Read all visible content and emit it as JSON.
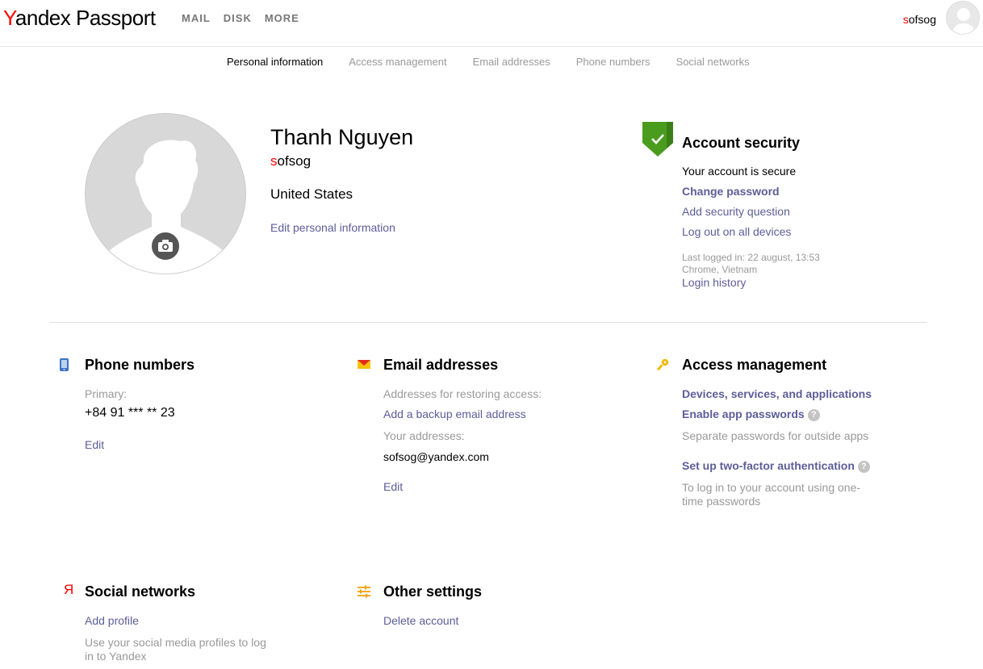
{
  "header": {
    "logo_brand_first": "Y",
    "logo_brand_rest": "andex",
    "logo_product": "Passport",
    "nav": [
      "MAIL",
      "DISK",
      "MORE"
    ],
    "user_first": "s",
    "user_rest": "ofsog"
  },
  "tabs": [
    "Personal information",
    "Access management",
    "Email addresses",
    "Phone numbers",
    "Social networks"
  ],
  "profile": {
    "name": "Thanh Nguyen",
    "login_first": "s",
    "login_rest": "ofsog",
    "country": "United States",
    "edit_link": "Edit personal information"
  },
  "security": {
    "title": "Account security",
    "status": "Your account is secure",
    "change_password": "Change password",
    "add_question": "Add security question",
    "logout_all": "Log out on all devices",
    "last_login": "Last logged in: 22 august, 13:53",
    "last_device": "Chrome, Vietnam",
    "login_history": "Login history"
  },
  "phones": {
    "title": "Phone numbers",
    "primary_label": "Primary:",
    "primary_value": "+84 91 *** ** 23",
    "edit": "Edit"
  },
  "emails": {
    "title": "Email addresses",
    "restore_label": "Addresses for restoring access:",
    "add_backup": "Add a backup email address",
    "your_label": "Your addresses:",
    "address": "sofsog@yandex.com",
    "edit": "Edit"
  },
  "access": {
    "title": "Access management",
    "devices": "Devices, services, and applications",
    "app_passwords": "Enable app passwords",
    "app_passwords_desc": "Separate passwords for outside apps",
    "two_factor": "Set up two-factor authentication",
    "two_factor_desc_1": "To log in to your account using one-",
    "two_factor_desc_2": "time passwords",
    "help_glyph": "?"
  },
  "social": {
    "title": "Social networks",
    "icon_glyph": "Я",
    "add_profile": "Add profile",
    "desc_1": "Use your social media profiles to log",
    "desc_2": "in to Yandex"
  },
  "other": {
    "title": "Other settings",
    "delete": "Delete account"
  },
  "colors": {
    "link": "#5c5d99",
    "brand_red": "#ff0000",
    "shield_green": "#4a9c1e",
    "muted": "#999999"
  }
}
